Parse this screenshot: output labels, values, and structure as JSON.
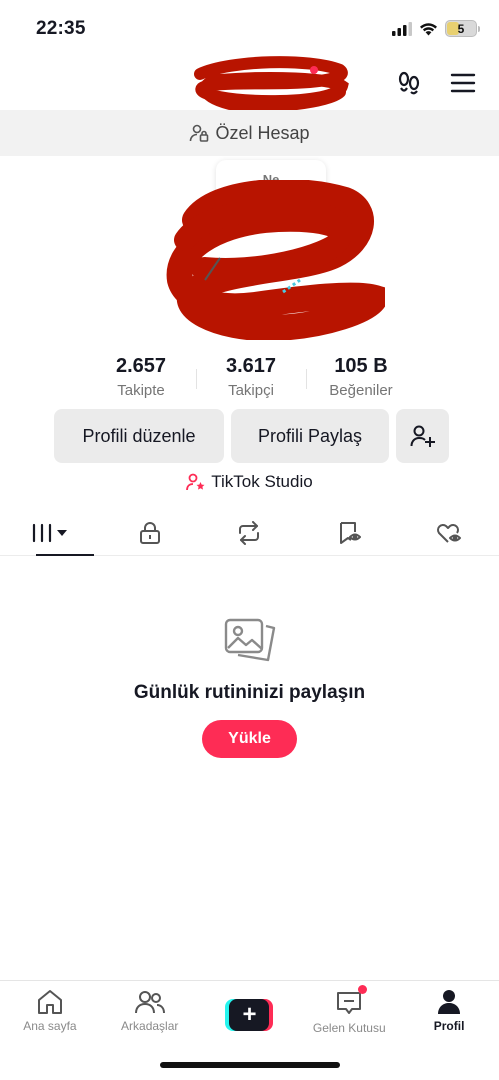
{
  "status_bar": {
    "time": "22:35",
    "battery": "5"
  },
  "banner": {
    "label": "Özel Hesap"
  },
  "note": {
    "text": "Ne"
  },
  "stats": [
    {
      "value": "2.657",
      "label": "Takipte"
    },
    {
      "value": "3.617",
      "label": "Takipçi"
    },
    {
      "value": "105 B",
      "label": "Beğeniler"
    }
  ],
  "actions": {
    "edit": "Profili düzenle",
    "share": "Profili Paylaş"
  },
  "studio": {
    "label": "TikTok Studio"
  },
  "empty_state": {
    "title": "Günlük rutininizi paylaşın",
    "upload": "Yükle"
  },
  "nav": {
    "home": "Ana sayfa",
    "friends": "Arkadaşlar",
    "inbox": "Gelen Kutusu",
    "profile": "Profil"
  },
  "colors": {
    "accent": "#fe2c55",
    "redaction": "#b81400"
  },
  "icons": [
    "signal-icon",
    "wifi-icon",
    "footprints-icon",
    "menu-icon",
    "person-lock-icon",
    "add-friend-icon",
    "studio-icon",
    "grid-icon",
    "lock-icon",
    "repost-icon",
    "bookmark-icon",
    "heart-icon",
    "image-icon",
    "home-icon",
    "friends-icon",
    "inbox-icon",
    "profile-icon"
  ]
}
